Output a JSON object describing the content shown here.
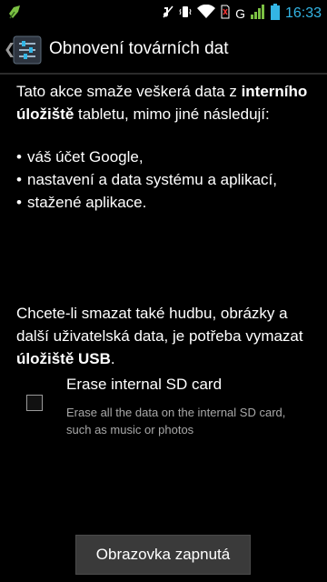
{
  "status_bar": {
    "time": "16:33",
    "network_type": "G",
    "icons": [
      "notification-icon",
      "mute-icon",
      "vibrate-icon",
      "wifi-icon",
      "no-sim-icon",
      "signal-icon",
      "battery-icon"
    ]
  },
  "action_bar": {
    "title": "Obnovení továrních dat",
    "back_glyph": "❮"
  },
  "body": {
    "intro_before": "Tato akce smaže veškerá data z ",
    "intro_bold": "interního úložiště",
    "intro_after": " tabletu, mimo jiné následují:",
    "bullets": [
      "váš účet Google,",
      "nastavení a data systému a aplikací,",
      "stažené aplikace."
    ],
    "bullet_glyph": "•",
    "second_before": "Chcete-li smazat také hudbu, obrázky a další uživatelská data, je potřeba vymazat ",
    "second_bold": "úložiště USB",
    "second_after": "."
  },
  "option": {
    "title": "Erase internal SD card",
    "summary": "Erase all the data on the internal SD card, such as music or photos",
    "checked": false
  },
  "bottom_button": {
    "label": "Obrazovka zapnutá"
  },
  "colors": {
    "accent": "#33b5e5",
    "background": "#000000",
    "secondary_text": "#a8a8a8",
    "battery": "#33b5e5",
    "notification_icon": "#7bc043"
  }
}
